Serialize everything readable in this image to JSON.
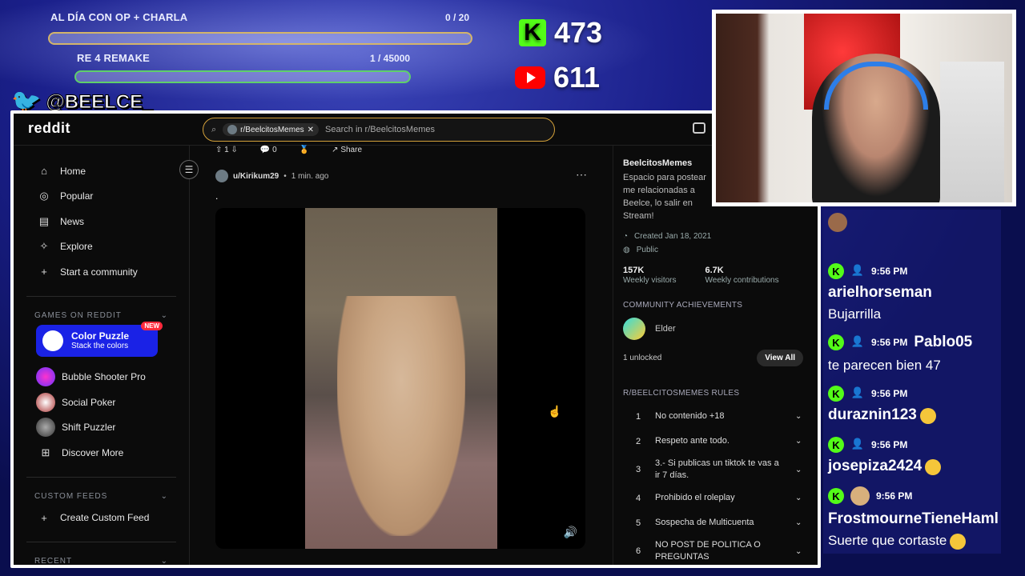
{
  "overlay": {
    "goal1": {
      "title": "AL DÍA CON OP + CHARLA",
      "count": "0 / 20",
      "progress": 0.0
    },
    "goal2": {
      "title": "RE 4 REMAKE",
      "count": "1 / 45000",
      "progress": 0.0
    },
    "kick_count": "473",
    "youtube_count": "611",
    "twitter_handle": "@BEELCE_",
    "kick_logo": "K"
  },
  "browser": {
    "logo": "reddit",
    "search": {
      "chip": "r/BeelcitosMemes",
      "placeholder": "Search in r/BeelcitosMemes"
    },
    "nav": [
      {
        "icon": "home-icon",
        "glyph": "⌂",
        "label": "Home"
      },
      {
        "icon": "popular-icon",
        "glyph": "◎",
        "label": "Popular"
      },
      {
        "icon": "news-icon",
        "glyph": "▤",
        "label": "News"
      },
      {
        "icon": "explore-icon",
        "glyph": "✧",
        "label": "Explore"
      },
      {
        "icon": "plus-icon",
        "glyph": "+",
        "label": "Start a community"
      }
    ],
    "games_header": "GAMES ON REDDIT",
    "featured_game": {
      "title": "Color Puzzle",
      "subtitle": "Stack the colors",
      "badge": "NEW"
    },
    "games": [
      "Bubble Shooter Pro",
      "Social Poker",
      "Shift Puzzler"
    ],
    "discover": "Discover More",
    "custom_feeds_header": "CUSTOM FEEDS",
    "create_feed": "Create Custom Feed",
    "recent_header": "RECENT",
    "post": {
      "upvotes": "1",
      "comments": "0",
      "share": "Share",
      "author": "u/Kirikum29",
      "time": "1 min. ago",
      "title": "."
    },
    "community": {
      "name": "BeelcitosMemes",
      "description": "Espacio para postear me relacionadas a Beelce, lo salir en Stream!",
      "created": "Created Jan 18, 2021",
      "visibility": "Public",
      "visitors": "157K",
      "visitors_label": "Weekly visitors",
      "contributions": "6.7K",
      "contributions_label": "Weekly contributions",
      "achievements_header": "COMMUNITY ACHIEVEMENTS",
      "achievement": "Elder",
      "unlocked": "1 unlocked",
      "view_all": "View All",
      "rules_header": "R/BEELCITOSMEMES RULES",
      "rules": [
        {
          "n": "1",
          "text": "No contenido +18"
        },
        {
          "n": "2",
          "text": "Respeto ante todo."
        },
        {
          "n": "3",
          "text": "3.- Si publicas un tiktok te vas a ir 7 días."
        },
        {
          "n": "4",
          "text": "Prohibido el roleplay"
        },
        {
          "n": "5",
          "text": "Sospecha de Multicuenta"
        },
        {
          "n": "6",
          "text": "NO POST DE POLITICA O PREGUNTAS"
        }
      ]
    }
  },
  "chat": [
    {
      "time": "9:56 PM",
      "user": "arielhorseman",
      "text": "Bujarrilla",
      "inline": false
    },
    {
      "time": "9:56 PM",
      "user": "Pablo05",
      "text": "te parecen bien 47",
      "inline": true
    },
    {
      "time": "9:56 PM",
      "user": "duraznin123",
      "text": "",
      "inline": false
    },
    {
      "time": "9:56 PM",
      "user": "josepiza2424",
      "text": "",
      "inline": false
    },
    {
      "time": "9:56 PM",
      "user": "FrostmourneTieneHaml",
      "text": "Suerte que cortaste",
      "inline": false
    }
  ],
  "colors": {
    "kick": "#53fc18",
    "youtube": "#ff0000",
    "reddit_bg": "#0b0b0b",
    "accent": "#1a22e6"
  }
}
